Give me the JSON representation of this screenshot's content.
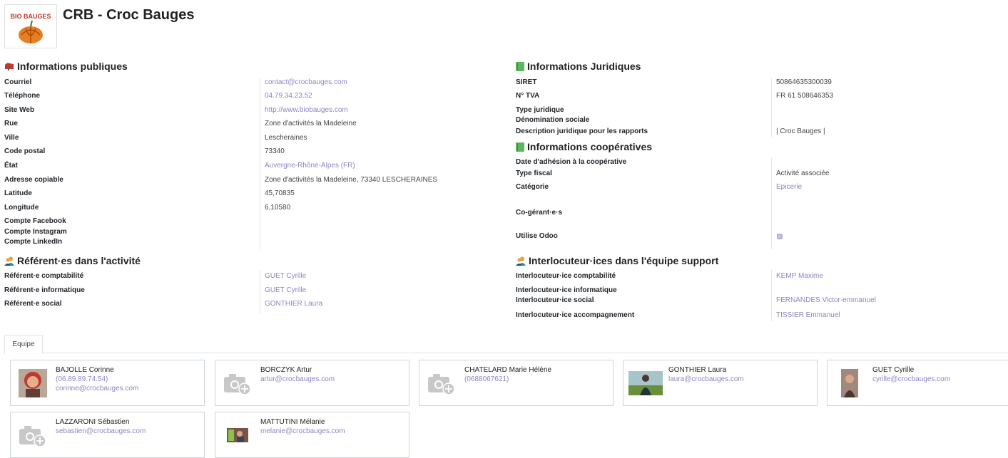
{
  "header": {
    "title": "CRB - Croc Bauges",
    "logo_text": "BIO BAUGES"
  },
  "public_info": {
    "title": "Informations publiques",
    "fields": [
      {
        "label": "Courriel",
        "value": "contact@crocbauges.com",
        "link": true
      },
      {
        "label": "Téléphone",
        "value": "04.79.34.23.52",
        "link": true
      },
      {
        "label": "Site Web",
        "value": "http://www.biobauges.com",
        "link": true
      },
      {
        "label": "Rue",
        "value": "Zone d'activités la Madeleine",
        "link": false
      },
      {
        "label": "Ville",
        "value": "Lescheraines",
        "link": false
      },
      {
        "label": "Code postal",
        "value": "73340",
        "link": false
      },
      {
        "label": "État",
        "value": "Auvergne-Rhône-Alpes (FR)",
        "link": true
      },
      {
        "label": "Adresse copiable",
        "value": "Zone d'activités la Madeleine, 73340 LESCHERAINES",
        "link": false
      },
      {
        "label": "Latitude",
        "value": "45,70835",
        "link": false
      },
      {
        "label": "Longitude",
        "value": "6,10580",
        "link": false
      },
      {
        "label": "Compte Facebook",
        "value": "",
        "link": false
      },
      {
        "label": "Compte Instagram",
        "value": "",
        "link": false
      },
      {
        "label": "Compte LinkedIn",
        "value": "",
        "link": false
      }
    ]
  },
  "referents": {
    "title": "Référent·es dans l'activité",
    "fields": [
      {
        "label": "Référent·e comptabilité",
        "value": "GUET Cyrille"
      },
      {
        "label": "Référent·e informatique",
        "value": "GUET Cyrille"
      },
      {
        "label": "Référent·e social",
        "value": "GONTHIER Laura"
      }
    ]
  },
  "legal_info": {
    "title": "Informations Juridiques",
    "fields": [
      {
        "label": "SIRET",
        "value": "50864635300039"
      },
      {
        "label": "N° TVA",
        "value": "FR 61 508646353"
      },
      {
        "label": "Type juridique",
        "value": ""
      },
      {
        "label": "Dénomination sociale",
        "value": ""
      },
      {
        "label": "Description juridique pour les rapports",
        "value": "| Croc Bauges |"
      }
    ]
  },
  "coop_info": {
    "title": "Informations coopératives",
    "fields": [
      {
        "label": "Date d'adhésion à la coopérative",
        "value": ""
      },
      {
        "label": "Type fiscal",
        "value": "Activité associée"
      },
      {
        "label": "Catégorie",
        "value": "Epicerie"
      },
      {
        "label": "Co-gérant·e·s",
        "value": ""
      },
      {
        "label": "Utilise Odoo",
        "value": "",
        "checked": true
      }
    ]
  },
  "support": {
    "title": "Interlocuteur·ices dans l'équipe support",
    "fields": [
      {
        "label": "Interlocuteur·ice comptabilité",
        "value": "KEMP Maxime"
      },
      {
        "label": "Interlocuteur·ice informatique",
        "value": ""
      },
      {
        "label": "Interlocuteur·ice social",
        "value": "FERNANDES Victor-emmanuel"
      },
      {
        "label": "Interlocuteur·ice accompagnement",
        "value": "TISSIER Emmanuel"
      }
    ]
  },
  "tabs": {
    "equipe": "Equipe"
  },
  "team": [
    {
      "name": "BAJOLLE Corinne",
      "line1": "(06.89.89.74.54)",
      "line2": "corinne@crocbauges.com",
      "photo": "red-hair"
    },
    {
      "name": "BORCZYK Artur",
      "line1": "artur@crocbauges.com",
      "line2": "",
      "photo": "placeholder"
    },
    {
      "name": "CHATELARD Marie Hélène",
      "line1": "(0688067621)",
      "line2": "",
      "photo": "placeholder"
    },
    {
      "name": "GONTHIER Laura",
      "line1": "laura@crocbauges.com",
      "line2": "",
      "photo": "outdoor"
    },
    {
      "name": "GUET Cyrille",
      "line1": "cyrille@crocbauges.com",
      "line2": "",
      "photo": "portrait"
    },
    {
      "name": "LAZZARONI Sébastien",
      "line1": "sebastien@crocbauges.com",
      "line2": "",
      "photo": "placeholder"
    },
    {
      "name": "MATTUTINI Mélanie",
      "line1": "melanie@crocbauges.com",
      "line2": "",
      "photo": "shop"
    }
  ],
  "colors": {
    "link": "#8f84c4",
    "legal_icon": "#5cb85c",
    "public_icon": "#c0392b",
    "people_icon": "#2e86c1"
  }
}
